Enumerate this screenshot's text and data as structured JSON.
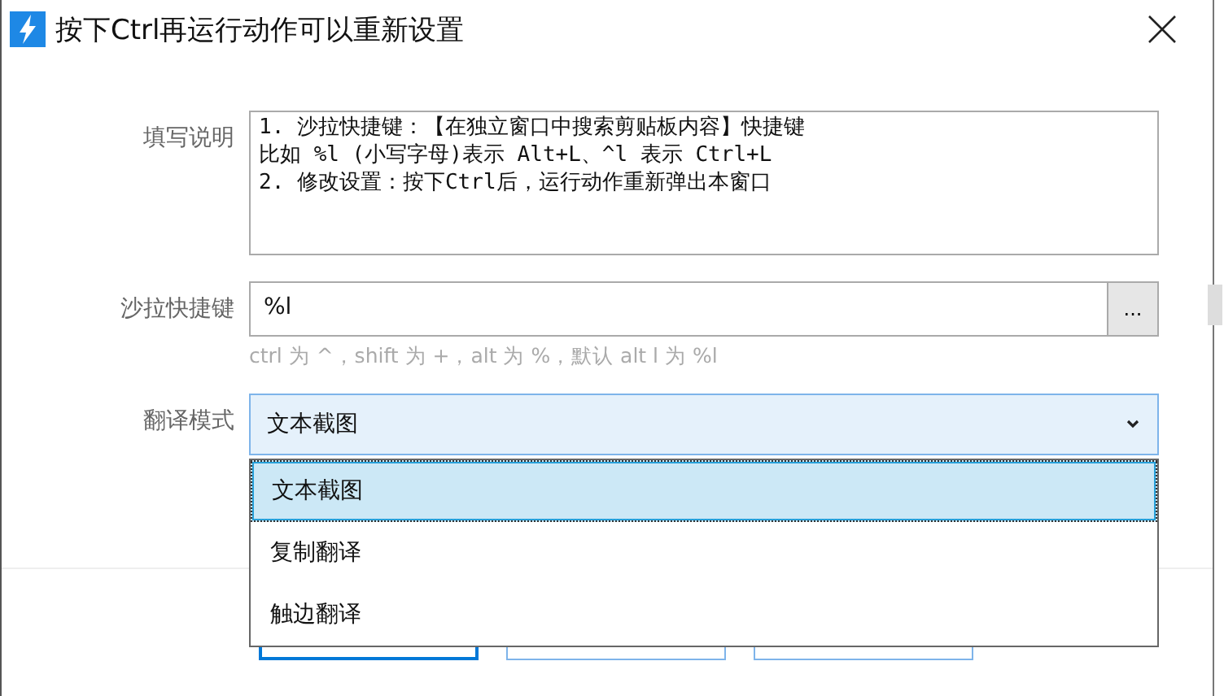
{
  "window": {
    "title": "按下Ctrl再运行动作可以重新设置"
  },
  "fields": [
    {
      "kind": "textarea",
      "label": "填写说明",
      "lines": [
        "1. 沙拉快捷键：【在独立窗口中搜索剪贴板内容】快捷键",
        "比如 %l (小写字母)表示 Alt+L、^l 表示 Ctrl+L",
        "2. 修改设置：按下Ctrl后，运行动作重新弹出本窗口"
      ]
    },
    {
      "kind": "input",
      "label": "沙拉快捷键",
      "value": "%l",
      "button": "...",
      "hint": "ctrl 为 ^，shift 为 +，alt 为 %，默认 alt l 为 %l"
    },
    {
      "kind": "select",
      "label": "翻译模式",
      "value": "文本截图",
      "expanded": true,
      "options": [
        {
          "label": "文本截图",
          "selected": true
        },
        {
          "label": "复制翻译",
          "selected": false
        },
        {
          "label": "触边翻译",
          "selected": false
        }
      ]
    }
  ],
  "buttons": [
    {
      "kind": "primary"
    },
    {
      "kind": "normal"
    },
    {
      "kind": "normal"
    }
  ]
}
